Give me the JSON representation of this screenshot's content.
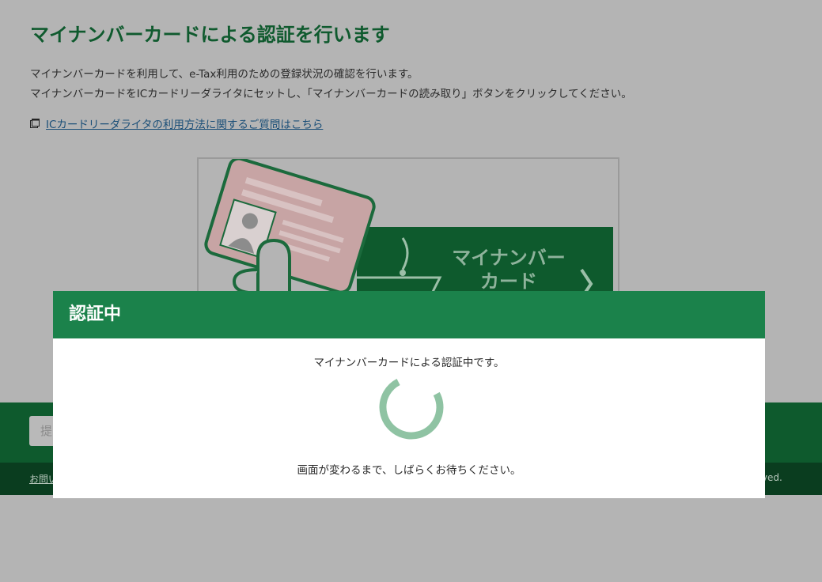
{
  "page": {
    "title": "マイナンバーカードによる認証を行います",
    "description_line1": "マイナンバーカードを利用して、e-Tax利用のための登録状況の確認を行います。",
    "description_line2": "マイナンバーカードをICカードリーダライタにセットし、「マイナンバーカードの読み取り」ボタンをクリックしてください。",
    "help_link": "ICカードリーダライタの利用方法に関するご質問はこちら"
  },
  "card_button": {
    "label_line1": "マイナンバー",
    "label_line2": "カード"
  },
  "footer": {
    "input_text": "提",
    "link_text": "お問い",
    "copyright_fragment": "rved."
  },
  "modal": {
    "title": "認証中",
    "message": "マイナンバーカードによる認証中です。",
    "wait_message": "画面が変わるまで、しばらくお待ちください。"
  },
  "colors": {
    "brand_green": "#1b824b",
    "dark_green": "#0e5a2d",
    "overlay_gray": "#b4b4b4",
    "spinner": "#8fc3a3"
  }
}
